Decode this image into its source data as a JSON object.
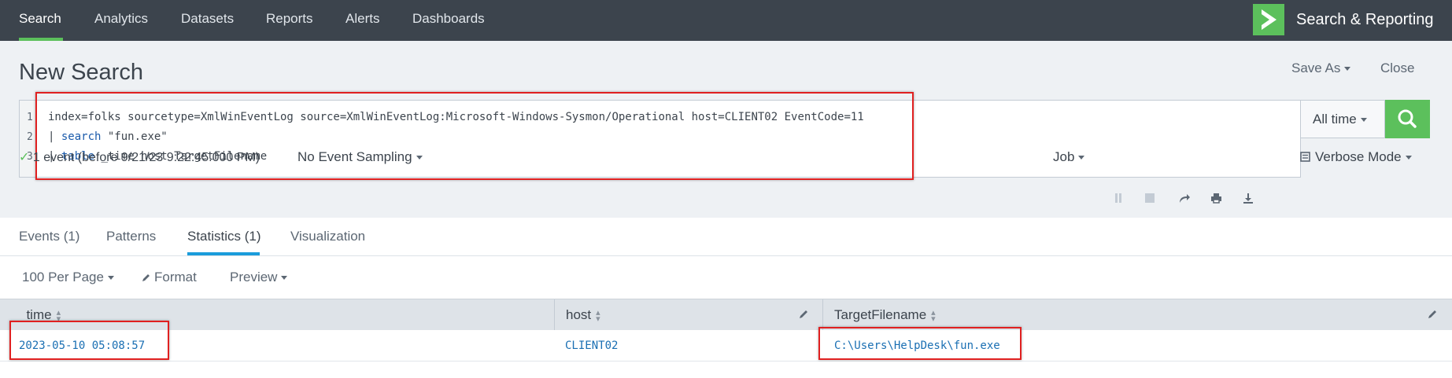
{
  "topnav": {
    "items": [
      "Search",
      "Analytics",
      "Datasets",
      "Reports",
      "Alerts",
      "Dashboards"
    ],
    "active": "Search",
    "app_title": "Search & Reporting",
    "app_icon": "chevron-right-logo-icon",
    "accent_color": "#5cc05c"
  },
  "header": {
    "title": "New Search",
    "save_as": "Save As",
    "close": "Close"
  },
  "query": {
    "line_numbers": [
      "1",
      "2",
      "3"
    ],
    "line1": "index=folks sourcetype=XmlWinEventLog source=XmlWinEventLog:Microsoft-Windows-Sysmon/Operational host=CLIENT02 EventCode=11",
    "line2_pipe": "| ",
    "line2_cmd": "search",
    "line2_rest": " \"fun.exe\"",
    "line3_pipe": "| ",
    "line3_cmd": "table",
    "line3_rest": " _time host TargetFilename"
  },
  "time_picker": {
    "label": "All time"
  },
  "status": {
    "check": "✓",
    "events_text": "1 event (before 9/21/23 9:22:45.000 PM)",
    "sampling": "No Event Sampling",
    "job": "Job",
    "mode": "Verbose Mode"
  },
  "tabs": [
    {
      "label": "Events (1)"
    },
    {
      "label": "Patterns"
    },
    {
      "label": "Statistics (1)"
    },
    {
      "label": "Visualization"
    }
  ],
  "active_tab": "Statistics (1)",
  "toolbar": {
    "per_page": "100 Per Page",
    "format": "Format",
    "preview": "Preview"
  },
  "table": {
    "columns": [
      "_time",
      "host",
      "TargetFilename"
    ],
    "rows": [
      [
        "2023-05-10 05:08:57",
        "CLIENT02",
        "C:\\Users\\HelpDesk\\fun.exe"
      ]
    ]
  }
}
